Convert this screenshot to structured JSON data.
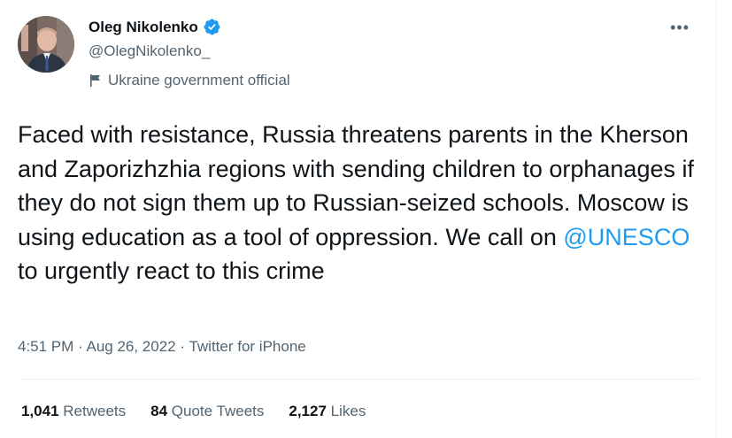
{
  "author": {
    "name": "Oleg Nikolenko",
    "handle": "@OlegNikolenko_",
    "affiliation": "Ukraine government official",
    "verified": true
  },
  "tweet": {
    "text_before": "Faced with resistance, Russia threatens parents in the Kherson and Zaporizhzhia regions with sending children to orphanages if they do not sign them up to Russian-seized schools. Moscow is using education as a tool of oppression. We call on ",
    "mention": "@UNESCO",
    "text_after": " to urgently react to this crime"
  },
  "meta": {
    "time": "4:51 PM",
    "separator": " · ",
    "date": "Aug 26, 2022",
    "source": "Twitter for iPhone"
  },
  "stats": {
    "retweets_count": "1,041",
    "retweets_label": " Retweets",
    "quotes_count": "84",
    "quotes_label": " Quote Tweets",
    "likes_count": "2,127",
    "likes_label": " Likes"
  },
  "colors": {
    "accent": "#1d9bf0",
    "secondary_text": "#536471",
    "primary_text": "#0f1419"
  },
  "icons": [
    "verified-badge-icon",
    "flag-icon",
    "more-options-icon"
  ]
}
